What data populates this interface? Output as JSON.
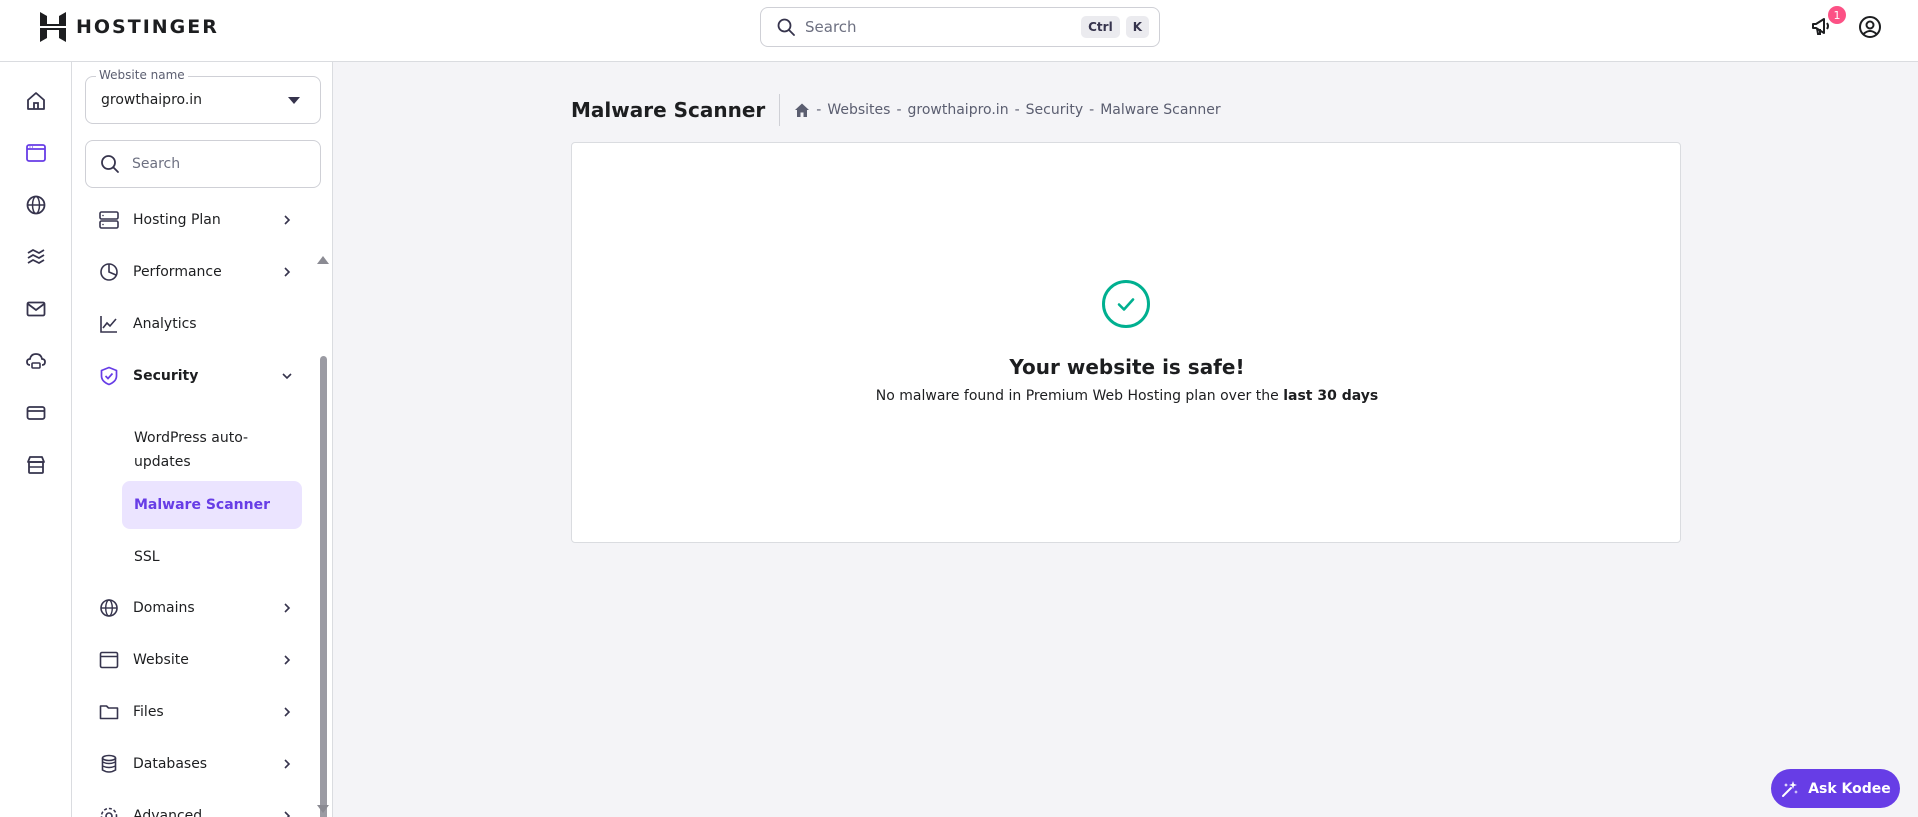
{
  "header": {
    "brand": "HOSTINGER",
    "search_placeholder": "Search",
    "shortcut_keys": [
      "Ctrl",
      "K"
    ],
    "notification_count": "1"
  },
  "rail": {
    "icons": [
      "home-icon",
      "website-icon",
      "globe-icon",
      "layers-icon",
      "mail-icon",
      "cloud-hosting-icon",
      "billing-card-icon",
      "store-icon"
    ],
    "active": "website-icon"
  },
  "sidebar": {
    "website_label": "Website name",
    "website_value": "growthaipro.in",
    "search_placeholder": "Search",
    "items": [
      {
        "label": "Hosting Plan",
        "icon": "server-icon",
        "chevron": "right"
      },
      {
        "label": "Performance",
        "icon": "pie-chart-icon",
        "chevron": "right"
      },
      {
        "label": "Analytics",
        "icon": "trend-chart-icon",
        "chevron": ""
      },
      {
        "label": "Security",
        "icon": "shield-check-icon",
        "chevron": "down"
      },
      {
        "label": "Domains",
        "icon": "globe-icon",
        "chevron": "right"
      },
      {
        "label": "Website",
        "icon": "browser-window-icon",
        "chevron": "right"
      },
      {
        "label": "Files",
        "icon": "folder-icon",
        "chevron": "right"
      },
      {
        "label": "Databases",
        "icon": "database-icon",
        "chevron": "right"
      },
      {
        "label": "Advanced",
        "icon": "gear-icon",
        "chevron": "right"
      }
    ],
    "security_sub": [
      {
        "label": "WordPress auto-updates"
      },
      {
        "label": "Malware Scanner",
        "active": true
      },
      {
        "label": "SSL"
      }
    ]
  },
  "main": {
    "title": "Malware Scanner",
    "breadcrumbs": [
      "Websites",
      "growthaipro.in",
      "Security",
      "Malware Scanner"
    ],
    "status_title": "Your website is safe!",
    "status_desc_prefix": "No malware found in Premium Web Hosting plan over the ",
    "status_desc_bold": "last 30 days"
  },
  "assistant": {
    "label": "Ask Kodee"
  },
  "colors": {
    "accent": "#673de6",
    "success": "#00b090",
    "badge": "#fc5185"
  }
}
